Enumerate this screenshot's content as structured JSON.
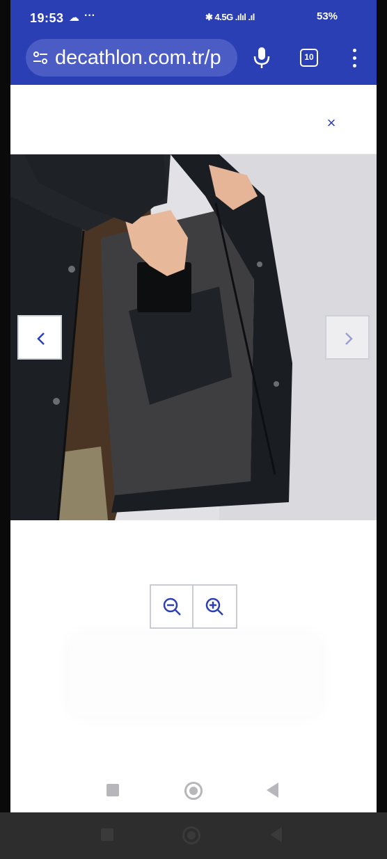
{
  "status_bar": {
    "time": "19:53",
    "cloud_icon": "cloud-icon",
    "more_indicator": "···",
    "network_info": "✱ 4.5G .ılıl .ıl",
    "battery": "53%"
  },
  "browser": {
    "url": "decathlon.com.tr/p",
    "site_info_icon": "tune-icon",
    "mic_icon": "mic-icon",
    "tab_count": "10",
    "menu_icon": "more-vert-icon",
    "accent_color": "#2b3fb4"
  },
  "viewer": {
    "close_icon": "close-icon",
    "close_label": "×",
    "image_alt": "Man putting a wallet into the inner pocket of a black jacket",
    "prev_icon": "chevron-left-icon",
    "next_icon": "chevron-right-icon",
    "zoom_out_icon": "zoom-out-icon",
    "zoom_in_icon": "zoom-in-icon"
  },
  "system_nav": {
    "recents_icon": "square-icon",
    "home_icon": "circle-icon",
    "back_icon": "triangle-back-icon"
  }
}
